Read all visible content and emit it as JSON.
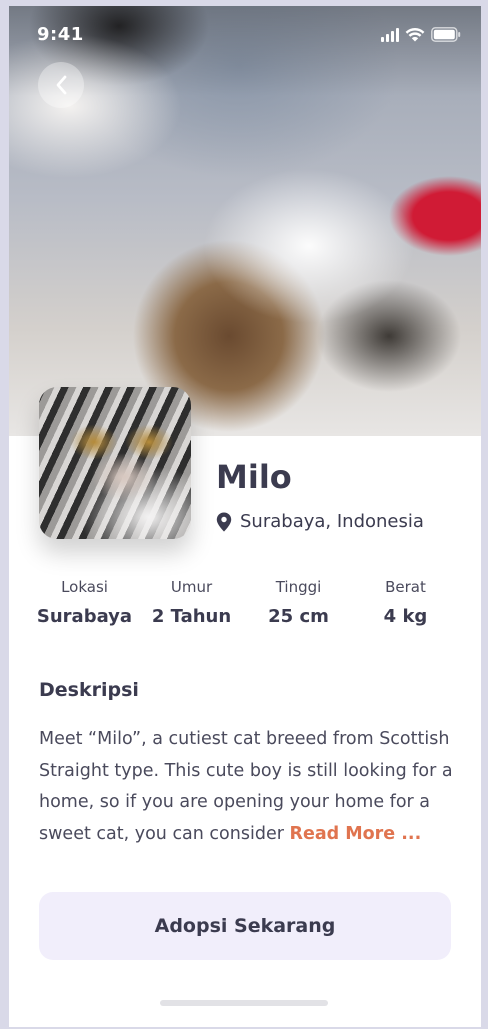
{
  "status_bar": {
    "time": "9:41"
  },
  "pet": {
    "name": "Milo",
    "location": "Surabaya, Indonesia"
  },
  "stats": [
    {
      "label": "Lokasi",
      "value": "Surabaya"
    },
    {
      "label": "Umur",
      "value": "2 Tahun"
    },
    {
      "label": "Tinggi",
      "value": "25 cm"
    },
    {
      "label": "Berat",
      "value": "4 kg"
    }
  ],
  "description": {
    "title": "Deskripsi",
    "text": "Meet “Milo”, a cutiest cat breeed from Scottish Straight type. This cute boy is still looking for a home, so if you are opening your home for a sweet cat, you can consider ",
    "read_more": "Read More ..."
  },
  "cta": {
    "label": "Adopsi Sekarang"
  },
  "colors": {
    "accent": "#e0744f",
    "primary_text": "#3b3b4f",
    "button_bg": "#f1eefb"
  },
  "icons": {
    "back": "chevron-left-icon",
    "location": "map-pin-icon",
    "signal": "cellular-signal-icon",
    "wifi": "wifi-icon",
    "battery": "battery-icon"
  }
}
